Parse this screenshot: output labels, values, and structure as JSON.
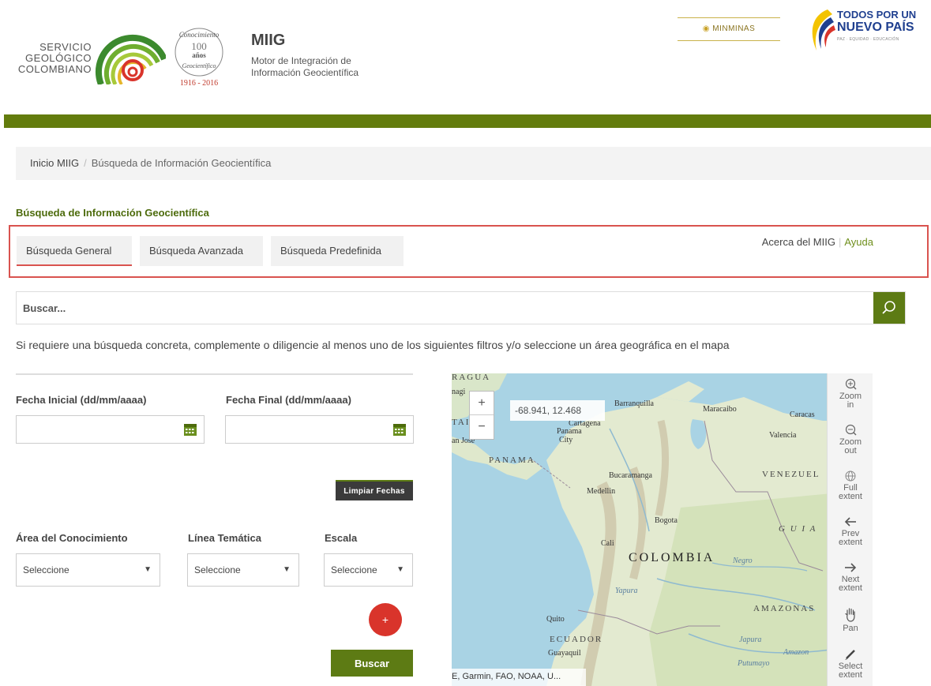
{
  "header": {
    "org_line1": "SERVICIO",
    "org_line2": "GEOLÓGICO",
    "org_line3": "COLOMBIANO",
    "seal_top": "Conocimiento",
    "seal_num": "100",
    "seal_anos": "años",
    "seal_bottom": "Geocientífico",
    "seal_years": "1916 - 2016",
    "title": "MIIG",
    "subtitle_line1": "Motor de Integración de",
    "subtitle_line2": "Información Geocientífica",
    "minminas": "MINMINAS",
    "todos_line1": "TODOS POR UN",
    "todos_line2": "NUEVO PAÍS",
    "todos_line3": "PAZ · EQUIDAD · EDUCACIÓN"
  },
  "breadcrumb": {
    "home": "Inicio MIIG",
    "separator": "/",
    "current": "Búsqueda de Información Geocientífica"
  },
  "section_title": "Búsqueda de Información Geocientífica",
  "tabs": [
    {
      "label": "Búsqueda General",
      "active": true
    },
    {
      "label": "Búsqueda Avanzada",
      "active": false
    },
    {
      "label": "Búsqueda Predefinida",
      "active": false
    }
  ],
  "links": {
    "about": "Acerca del MIIG",
    "separator": "|",
    "help": "Ayuda"
  },
  "search": {
    "placeholder": "Buscar..."
  },
  "hint": "Si requiere una búsqueda concreta, complemente o diligencie al menos uno de los siguientes filtros y/o seleccione un área geográfica en el mapa",
  "filters": {
    "start_date_label": "Fecha Inicial (dd/mm/aaaa)",
    "end_date_label": "Fecha Final (dd/mm/aaaa)",
    "start_date_value": "",
    "end_date_value": "",
    "clear_dates": "Limpiar Fechas",
    "area_label": "Área del Conocimiento",
    "linea_label": "Línea Temática",
    "escala_label": "Escala",
    "area_value": "Seleccione",
    "linea_value": "Seleccione",
    "escala_value": "Seleccione",
    "add_label": "+",
    "search_button": "Buscar"
  },
  "map": {
    "zoom_in": "+",
    "zoom_out": "−",
    "coords": "-68.941, 12.468",
    "attribution": "E, Garmin, FAO, NOAA, U...",
    "labels": {
      "ragua": "RAGUA",
      "nag": "nagi",
      "tai": "TAI",
      "san_jose": "an Jose",
      "barranquilla": "Barranquilla",
      "maracaibo": "Maracaibo",
      "caracas": "Caracas",
      "cartagena": "Cartagena",
      "panama": "Panama",
      "city": "City",
      "valencia": "Valencia",
      "panama_country": "PANAMA",
      "bucaramanga": "Bucaramanga",
      "venezuela": "VENEZUEL",
      "medellin": "Medellin",
      "bogota": "Bogota",
      "guia": "G U I A",
      "cali": "Cali",
      "colombia": "COLOMBIA",
      "negro": "Negro",
      "amazonas": "AMAZONAS",
      "quito": "Quito",
      "ecuador": "ECUADOR",
      "guayaquil": "Guayaquil",
      "japura": "Japura",
      "amazon": "Amazon",
      "putumayo": "Putumayo",
      "yapura": "Yapura"
    }
  },
  "toolbar": [
    {
      "icon": "zoom-in-icon",
      "line1": "Zoom",
      "line2": "in"
    },
    {
      "icon": "zoom-out-icon",
      "line1": "Zoom",
      "line2": "out"
    },
    {
      "icon": "globe-icon",
      "line1": "Full",
      "line2": "extent"
    },
    {
      "icon": "arrow-left-icon",
      "line1": "Prev",
      "line2": "extent"
    },
    {
      "icon": "arrow-right-icon",
      "line1": "Next",
      "line2": "extent"
    },
    {
      "icon": "hand-icon",
      "line1": "Pan",
      "line2": ""
    },
    {
      "icon": "pencil-icon",
      "line1": "Select",
      "line2": "extent"
    }
  ],
  "colors": {
    "brand_green": "#5d7b14",
    "header_bar": "#637c0d",
    "accent_red": "#d9534f",
    "add_button": "#d9342b",
    "section_title": "#4d6b0c"
  }
}
